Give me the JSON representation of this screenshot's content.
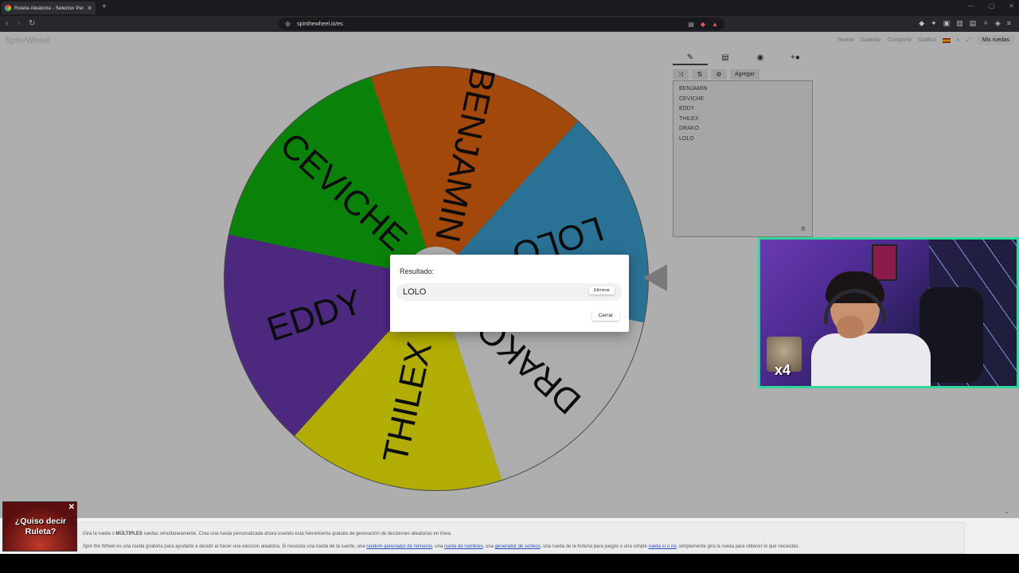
{
  "browser": {
    "tab_title": "Ruleta Aleatoria - Selector Perso...",
    "url": "spinthewheel.io/es"
  },
  "site": {
    "logo": "Spin•Wheel",
    "menu": [
      "Nuevo",
      "Guardar",
      "Compartir",
      "Gráfico"
    ],
    "my_wheels": "Mis ruedas"
  },
  "wheel": {
    "segments": [
      {
        "label": "BENJAMIN",
        "color": "#e0650f"
      },
      {
        "label": "LOLO",
        "color": "#3a9fcf"
      },
      {
        "label": "DRAKO",
        "color": "#f0f0f0"
      },
      {
        "label": "THILEX",
        "color": "#f6f004"
      },
      {
        "label": "EDDY",
        "color": "#6a3ab0"
      },
      {
        "label": "CEVICHE",
        "color": "#0fb40f"
      }
    ]
  },
  "editor": {
    "add_label": "Agregar",
    "entries": [
      "BENJAMIN",
      "CEVICHE",
      "EDDY",
      "THILEX",
      "DRAKO",
      "LOLO"
    ]
  },
  "dialog": {
    "title": "Resultado:",
    "result": "LOLO",
    "remove_label": "Eliminar",
    "close_label": "Cerrar"
  },
  "webcam": {
    "badge": "x4"
  },
  "ad": {
    "text": "¿Quiso decir Ruleta?"
  },
  "footer": {
    "line1_pre": "Gira la rueda o ",
    "line1_bold": "MÚLTIPLES",
    "line1_post": " ruedas simultáneamente. Crea una rueda personalizada ahora usando esta herramienta gratuita de generación de decisiones aleatorias en línea.",
    "line2_a": "Spin the Wheel es una rueda giratoria para ayudarte a decidir al hacer una elección aleatoria. Si necesita una rueda de la suerte, una ",
    "link1": "random generador de números",
    "line2_b": ", una ",
    "link2": "rueda de nombres",
    "line2_c": ", una ",
    "link3": "generador de sorteos",
    "line2_d": ", una rueda de la fortuna para juegos o una simple ",
    "link4": "rueda sí o no",
    "line2_e": ", simplemente gira la rueda para obtener lo que necesitas."
  }
}
